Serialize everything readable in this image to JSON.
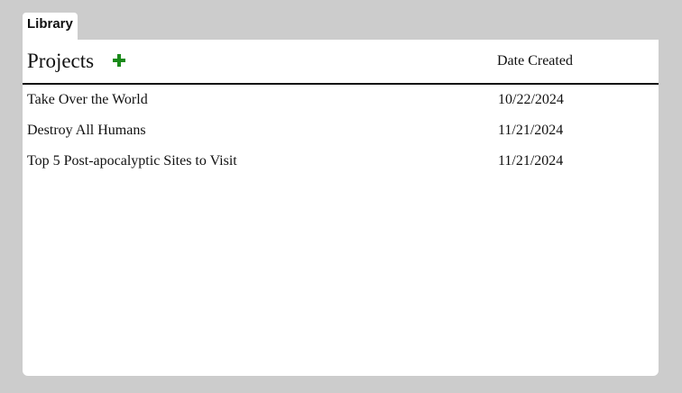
{
  "tab": {
    "label": "Library"
  },
  "header": {
    "title": "Projects",
    "add_icon": "plus-icon",
    "add_color": "#1a8a1a",
    "date_column": "Date Created"
  },
  "projects": [
    {
      "name": "Take Over the World",
      "date": "10/22/2024"
    },
    {
      "name": "Destroy All Humans",
      "date": "11/21/2024"
    },
    {
      "name": "Top 5 Post-apocalyptic Sites to Visit",
      "date": "11/21/2024"
    }
  ]
}
